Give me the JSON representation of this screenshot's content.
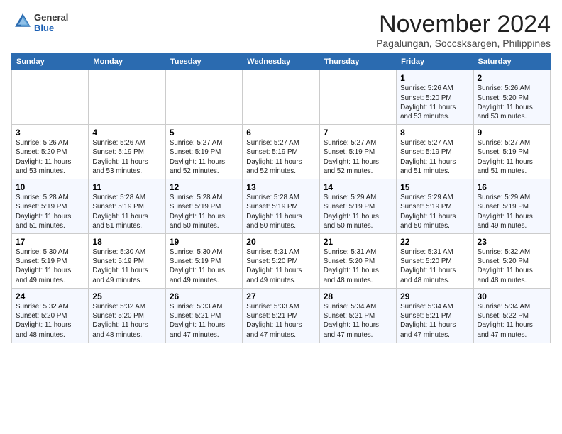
{
  "header": {
    "logo_general": "General",
    "logo_blue": "Blue",
    "month_title": "November 2024",
    "subtitle": "Pagalungan, Soccsksargen, Philippines"
  },
  "columns": [
    "Sunday",
    "Monday",
    "Tuesday",
    "Wednesday",
    "Thursday",
    "Friday",
    "Saturday"
  ],
  "weeks": [
    [
      {
        "day": "",
        "info": ""
      },
      {
        "day": "",
        "info": ""
      },
      {
        "day": "",
        "info": ""
      },
      {
        "day": "",
        "info": ""
      },
      {
        "day": "",
        "info": ""
      },
      {
        "day": "1",
        "info": "Sunrise: 5:26 AM\nSunset: 5:20 PM\nDaylight: 11 hours\nand 53 minutes."
      },
      {
        "day": "2",
        "info": "Sunrise: 5:26 AM\nSunset: 5:20 PM\nDaylight: 11 hours\nand 53 minutes."
      }
    ],
    [
      {
        "day": "3",
        "info": "Sunrise: 5:26 AM\nSunset: 5:20 PM\nDaylight: 11 hours\nand 53 minutes."
      },
      {
        "day": "4",
        "info": "Sunrise: 5:26 AM\nSunset: 5:19 PM\nDaylight: 11 hours\nand 53 minutes."
      },
      {
        "day": "5",
        "info": "Sunrise: 5:27 AM\nSunset: 5:19 PM\nDaylight: 11 hours\nand 52 minutes."
      },
      {
        "day": "6",
        "info": "Sunrise: 5:27 AM\nSunset: 5:19 PM\nDaylight: 11 hours\nand 52 minutes."
      },
      {
        "day": "7",
        "info": "Sunrise: 5:27 AM\nSunset: 5:19 PM\nDaylight: 11 hours\nand 52 minutes."
      },
      {
        "day": "8",
        "info": "Sunrise: 5:27 AM\nSunset: 5:19 PM\nDaylight: 11 hours\nand 51 minutes."
      },
      {
        "day": "9",
        "info": "Sunrise: 5:27 AM\nSunset: 5:19 PM\nDaylight: 11 hours\nand 51 minutes."
      }
    ],
    [
      {
        "day": "10",
        "info": "Sunrise: 5:28 AM\nSunset: 5:19 PM\nDaylight: 11 hours\nand 51 minutes."
      },
      {
        "day": "11",
        "info": "Sunrise: 5:28 AM\nSunset: 5:19 PM\nDaylight: 11 hours\nand 51 minutes."
      },
      {
        "day": "12",
        "info": "Sunrise: 5:28 AM\nSunset: 5:19 PM\nDaylight: 11 hours\nand 50 minutes."
      },
      {
        "day": "13",
        "info": "Sunrise: 5:28 AM\nSunset: 5:19 PM\nDaylight: 11 hours\nand 50 minutes."
      },
      {
        "day": "14",
        "info": "Sunrise: 5:29 AM\nSunset: 5:19 PM\nDaylight: 11 hours\nand 50 minutes."
      },
      {
        "day": "15",
        "info": "Sunrise: 5:29 AM\nSunset: 5:19 PM\nDaylight: 11 hours\nand 50 minutes."
      },
      {
        "day": "16",
        "info": "Sunrise: 5:29 AM\nSunset: 5:19 PM\nDaylight: 11 hours\nand 49 minutes."
      }
    ],
    [
      {
        "day": "17",
        "info": "Sunrise: 5:30 AM\nSunset: 5:19 PM\nDaylight: 11 hours\nand 49 minutes."
      },
      {
        "day": "18",
        "info": "Sunrise: 5:30 AM\nSunset: 5:19 PM\nDaylight: 11 hours\nand 49 minutes."
      },
      {
        "day": "19",
        "info": "Sunrise: 5:30 AM\nSunset: 5:19 PM\nDaylight: 11 hours\nand 49 minutes."
      },
      {
        "day": "20",
        "info": "Sunrise: 5:31 AM\nSunset: 5:20 PM\nDaylight: 11 hours\nand 49 minutes."
      },
      {
        "day": "21",
        "info": "Sunrise: 5:31 AM\nSunset: 5:20 PM\nDaylight: 11 hours\nand 48 minutes."
      },
      {
        "day": "22",
        "info": "Sunrise: 5:31 AM\nSunset: 5:20 PM\nDaylight: 11 hours\nand 48 minutes."
      },
      {
        "day": "23",
        "info": "Sunrise: 5:32 AM\nSunset: 5:20 PM\nDaylight: 11 hours\nand 48 minutes."
      }
    ],
    [
      {
        "day": "24",
        "info": "Sunrise: 5:32 AM\nSunset: 5:20 PM\nDaylight: 11 hours\nand 48 minutes."
      },
      {
        "day": "25",
        "info": "Sunrise: 5:32 AM\nSunset: 5:20 PM\nDaylight: 11 hours\nand 48 minutes."
      },
      {
        "day": "26",
        "info": "Sunrise: 5:33 AM\nSunset: 5:21 PM\nDaylight: 11 hours\nand 47 minutes."
      },
      {
        "day": "27",
        "info": "Sunrise: 5:33 AM\nSunset: 5:21 PM\nDaylight: 11 hours\nand 47 minutes."
      },
      {
        "day": "28",
        "info": "Sunrise: 5:34 AM\nSunset: 5:21 PM\nDaylight: 11 hours\nand 47 minutes."
      },
      {
        "day": "29",
        "info": "Sunrise: 5:34 AM\nSunset: 5:21 PM\nDaylight: 11 hours\nand 47 minutes."
      },
      {
        "day": "30",
        "info": "Sunrise: 5:34 AM\nSunset: 5:22 PM\nDaylight: 11 hours\nand 47 minutes."
      }
    ]
  ]
}
